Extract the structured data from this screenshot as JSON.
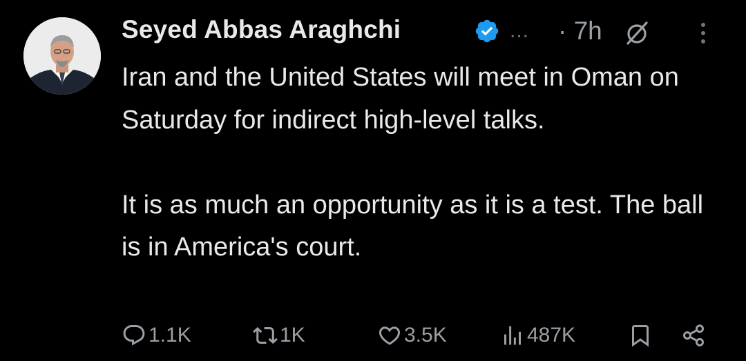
{
  "tweet": {
    "author": {
      "name": "Seyed Abbas Araghchi",
      "verified": true,
      "handle_truncated": "...",
      "avatar": "avatar-photo"
    },
    "time": "· 7h",
    "text_paragraphs": [
      "Iran and the United States will meet in Oman on Saturday for indirect high-level talks.",
      "It is as much an opportunity as it is a test. The ball is in America's court."
    ],
    "metrics": {
      "replies": "1.1K",
      "reposts": "1K",
      "likes": "3.5K",
      "views": "487K"
    }
  },
  "icons": {
    "verified": "verified-badge-icon",
    "grok": "grok-icon",
    "more": "more-vertical-icon",
    "reply": "reply-icon",
    "repost": "repost-icon",
    "like": "heart-icon",
    "views": "views-icon",
    "bookmark": "bookmark-icon",
    "share": "share-icon"
  },
  "colors": {
    "background": "#000000",
    "text_primary": "#e7e9ea",
    "text_secondary": "#9aa0a6",
    "verified_blue": "#1d9bf0"
  }
}
